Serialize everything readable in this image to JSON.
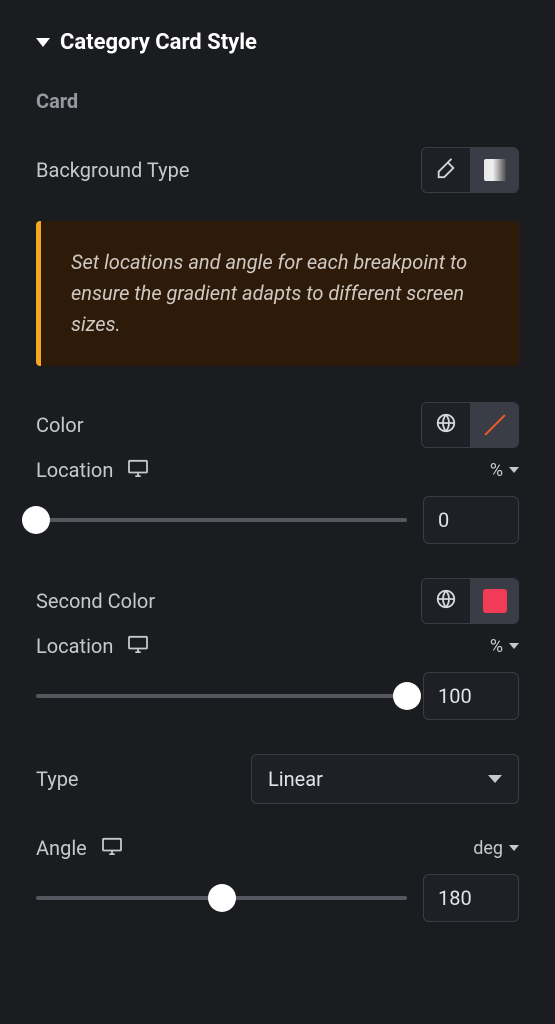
{
  "section": {
    "title": "Category Card Style",
    "subheader": "Card"
  },
  "backgroundType": {
    "label": "Background Type"
  },
  "notice": "Set locations and angle for each breakpoint to ensure the gradient adapts to different screen sizes.",
  "color1": {
    "label": "Color",
    "swatch": "transparent",
    "location": {
      "label": "Location",
      "unit": "%",
      "value": "0",
      "percent": 0
    }
  },
  "color2": {
    "label": "Second Color",
    "swatch": "#f23b57",
    "location": {
      "label": "Location",
      "unit": "%",
      "value": "100",
      "percent": 100
    }
  },
  "type": {
    "label": "Type",
    "value": "Linear"
  },
  "angle": {
    "label": "Angle",
    "unit": "deg",
    "value": "180",
    "percent": 50
  }
}
